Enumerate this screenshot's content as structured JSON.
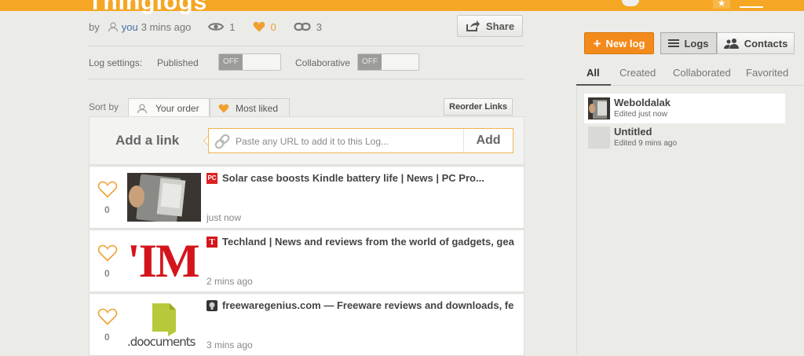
{
  "header": {
    "logo_fragment": "Thinglogs"
  },
  "meta": {
    "by": "by",
    "author": "you",
    "time_ago": "3 mins ago",
    "views": "1",
    "likes": "0",
    "links": "3"
  },
  "share": {
    "label": "Share"
  },
  "settings": {
    "label": "Log settings:",
    "published": {
      "label": "Published",
      "state": "OFF"
    },
    "collaborative": {
      "label": "Collaborative",
      "state": "OFF"
    }
  },
  "sort": {
    "label": "Sort by",
    "tabs": [
      {
        "label": "Your order"
      },
      {
        "label": "Most liked"
      }
    ]
  },
  "reorder": {
    "label": "Reorder Links"
  },
  "add_link": {
    "label": "Add a link",
    "placeholder": "Paste any URL to add it to this Log...",
    "button": "Add"
  },
  "links": [
    {
      "title": "Solar case boosts Kindle battery life | News | PC Pro...",
      "when": "just now",
      "likes": "0",
      "favicon": "pc-pro-favicon"
    },
    {
      "title": "Techland | News and reviews from the world of gadgets, gea",
      "when": "2 mins ago",
      "likes": "0",
      "favicon": "time-techland-favicon",
      "thumb_text": "'IM"
    },
    {
      "title": "freewaregenius.com — Freeware reviews and downloads, fe",
      "when": "3 mins ago",
      "likes": "0",
      "favicon": "freewaregenius-favicon",
      "thumb_text": ".doocuments"
    }
  ],
  "sidebar": {
    "new_log": "New log",
    "logs_btn": "Logs",
    "contacts_btn": "Contacts",
    "tabs": [
      {
        "label": "All"
      },
      {
        "label": "Created"
      },
      {
        "label": "Collaborated"
      },
      {
        "label": "Favorited"
      }
    ],
    "logs": [
      {
        "name": "Weboldalak",
        "edited": "Edited just now"
      },
      {
        "name": "Untitled",
        "edited": "Edited 9 mins ago"
      }
    ]
  },
  "colors": {
    "accent": "#f5a623",
    "new_log": "#f28b1c",
    "heart": "#f0a030",
    "link_text": "#4a6fa5"
  }
}
